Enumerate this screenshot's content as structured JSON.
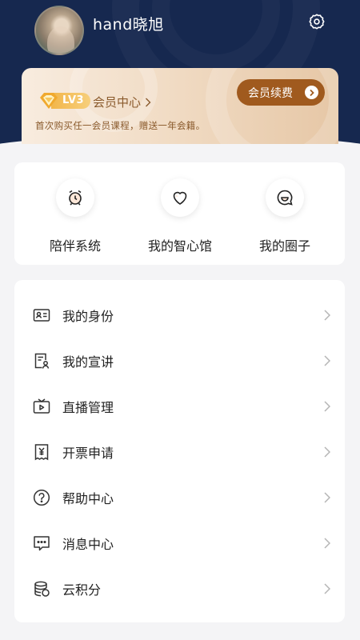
{
  "profile": {
    "username": "hand晓旭"
  },
  "icons": {
    "settings": "gear-icon",
    "chevron": "chevron-right-icon"
  },
  "membership": {
    "level": "LV3",
    "center_label": "会员中心",
    "renew_label": "会员续费",
    "promo_text": "首次购买任一会员课程，赠送一年会籍。"
  },
  "quick_actions": [
    {
      "label": "陪伴系统",
      "icon": "alarm-clock-icon"
    },
    {
      "label": "我的智心馆",
      "icon": "heart-icon"
    },
    {
      "label": "我的圈子",
      "icon": "smile-chat-icon"
    }
  ],
  "menu": [
    {
      "label": "我的身份",
      "icon": "id-card-icon"
    },
    {
      "label": "我的宣讲",
      "icon": "document-person-icon"
    },
    {
      "label": "直播管理",
      "icon": "tv-play-icon"
    },
    {
      "label": "开票申请",
      "icon": "invoice-icon"
    },
    {
      "label": "帮助中心",
      "icon": "help-circle-icon"
    },
    {
      "label": "消息中心",
      "icon": "message-icon"
    },
    {
      "label": "云积分",
      "icon": "coins-icon"
    }
  ],
  "colors": {
    "header_bg": "#16284f",
    "accent_brown": "#a05a1e",
    "gold": "#f2b64a"
  }
}
